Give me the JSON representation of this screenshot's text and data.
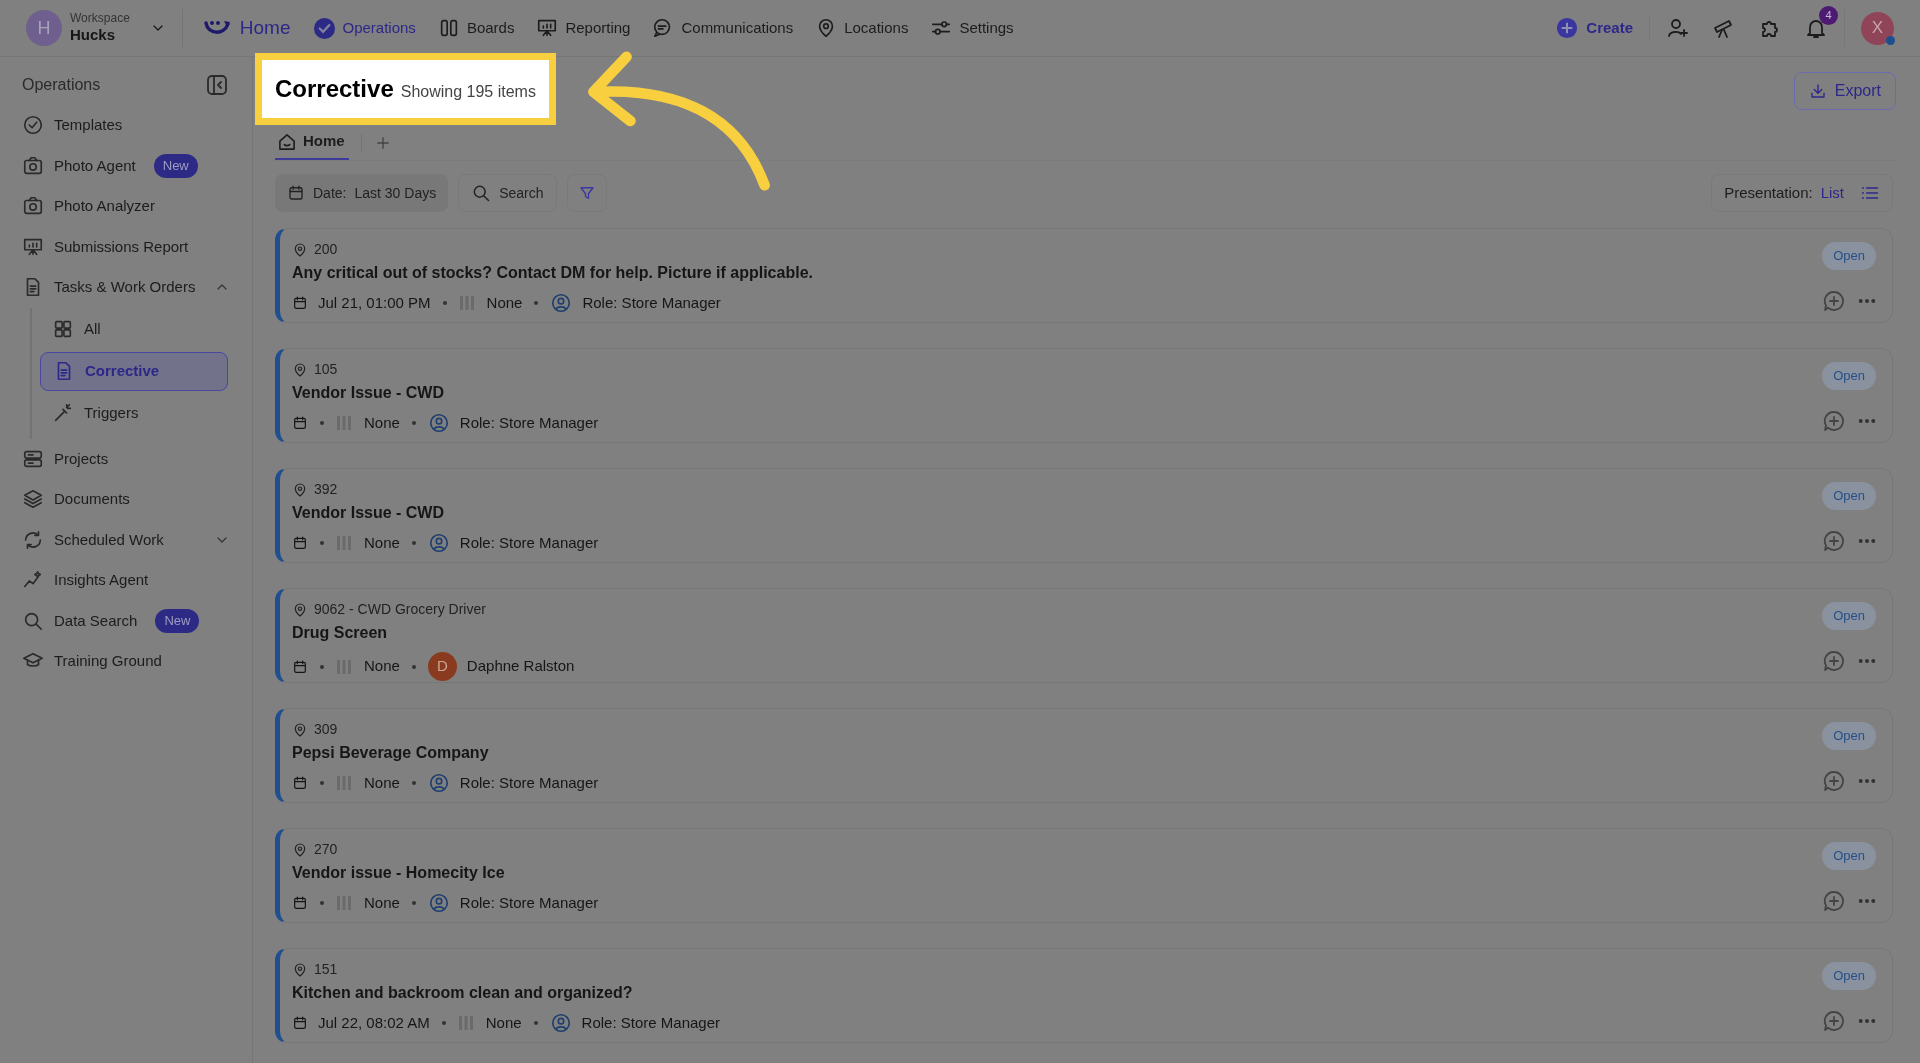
{
  "workspace": {
    "label": "Workspace",
    "name": "Hucks",
    "avatar": "H"
  },
  "home_link": "Home",
  "nav": [
    {
      "label": "Operations",
      "kind": "check",
      "selected": true
    },
    {
      "label": "Boards",
      "kind": "boards",
      "selected": false
    },
    {
      "label": "Reporting",
      "kind": "easel",
      "selected": false
    },
    {
      "label": "Communications",
      "kind": "chat",
      "selected": false
    },
    {
      "label": "Locations",
      "kind": "pin",
      "selected": false
    },
    {
      "label": "Settings",
      "kind": "sliders",
      "selected": false
    }
  ],
  "create_button": "Create",
  "notification_count": "4",
  "user_avatar": "X",
  "sidebar": {
    "title": "Operations",
    "items": [
      {
        "label": "Templates",
        "selected": false
      },
      {
        "label": "Photo Agent",
        "badge": "New",
        "selected": false
      },
      {
        "label": "Photo Analyzer",
        "selected": false
      },
      {
        "label": "Submissions Report",
        "selected": false
      },
      {
        "label": "Tasks & Work Orders",
        "selected": false,
        "expanded": true,
        "children": [
          {
            "label": "All",
            "selected": false
          },
          {
            "label": "Corrective",
            "selected": true
          },
          {
            "label": "Triggers",
            "selected": false
          }
        ]
      },
      {
        "label": "Projects",
        "selected": false
      },
      {
        "label": "Documents",
        "selected": false
      },
      {
        "label": "Scheduled Work",
        "selected": false,
        "expanded": false
      },
      {
        "label": "Insights Agent",
        "selected": false
      },
      {
        "label": "Data Search",
        "badge": "New",
        "selected": false
      },
      {
        "label": "Training Ground",
        "selected": false
      }
    ]
  },
  "page": {
    "title": "Corrective",
    "count": "Showing 195 items",
    "export": "Export"
  },
  "tabs": [
    {
      "label": "Home",
      "selected": true
    }
  ],
  "filters": {
    "date_label": "Date:",
    "date_value": "Last 30 Days",
    "search": "Search",
    "presentation_label": "Presentation:",
    "presentation_value": "List"
  },
  "rows": [
    {
      "location": "200",
      "title": "Any critical out of stocks? Contact DM for help. Picture if applicable.",
      "date": "Jul 21, 01:00 PM",
      "priority": "None",
      "kind": "role",
      "assignee": "Role: Store Manager",
      "status": "Open"
    },
    {
      "location": "105",
      "title": "Vendor Issue - CWD",
      "priority": "None",
      "kind": "role",
      "assignee": "Role: Store Manager",
      "status": "Open"
    },
    {
      "location": "392",
      "title": "Vendor Issue - CWD",
      "priority": "None",
      "kind": "role",
      "assignee": "Role: Store Manager",
      "status": "Open"
    },
    {
      "location": "9062 - CWD Grocery Driver",
      "title": "Drug Screen",
      "priority": "None",
      "kind": "person",
      "avatar": "D",
      "assignee": "Daphne Ralston",
      "status": "Open"
    },
    {
      "location": "309",
      "title": "Pepsi Beverage Company",
      "priority": "None",
      "kind": "role",
      "assignee": "Role: Store Manager",
      "status": "Open"
    },
    {
      "location": "270",
      "title": "Vendor issue - Homecity Ice",
      "priority": "None",
      "kind": "role",
      "assignee": "Role: Store Manager",
      "status": "Open"
    },
    {
      "location": "151",
      "title": "Kitchen and backroom clean and organized?",
      "date": "Jul 22, 08:02 AM",
      "priority": "None",
      "kind": "role",
      "assignee": "Role: Store Manager",
      "status": "Open"
    }
  ]
}
